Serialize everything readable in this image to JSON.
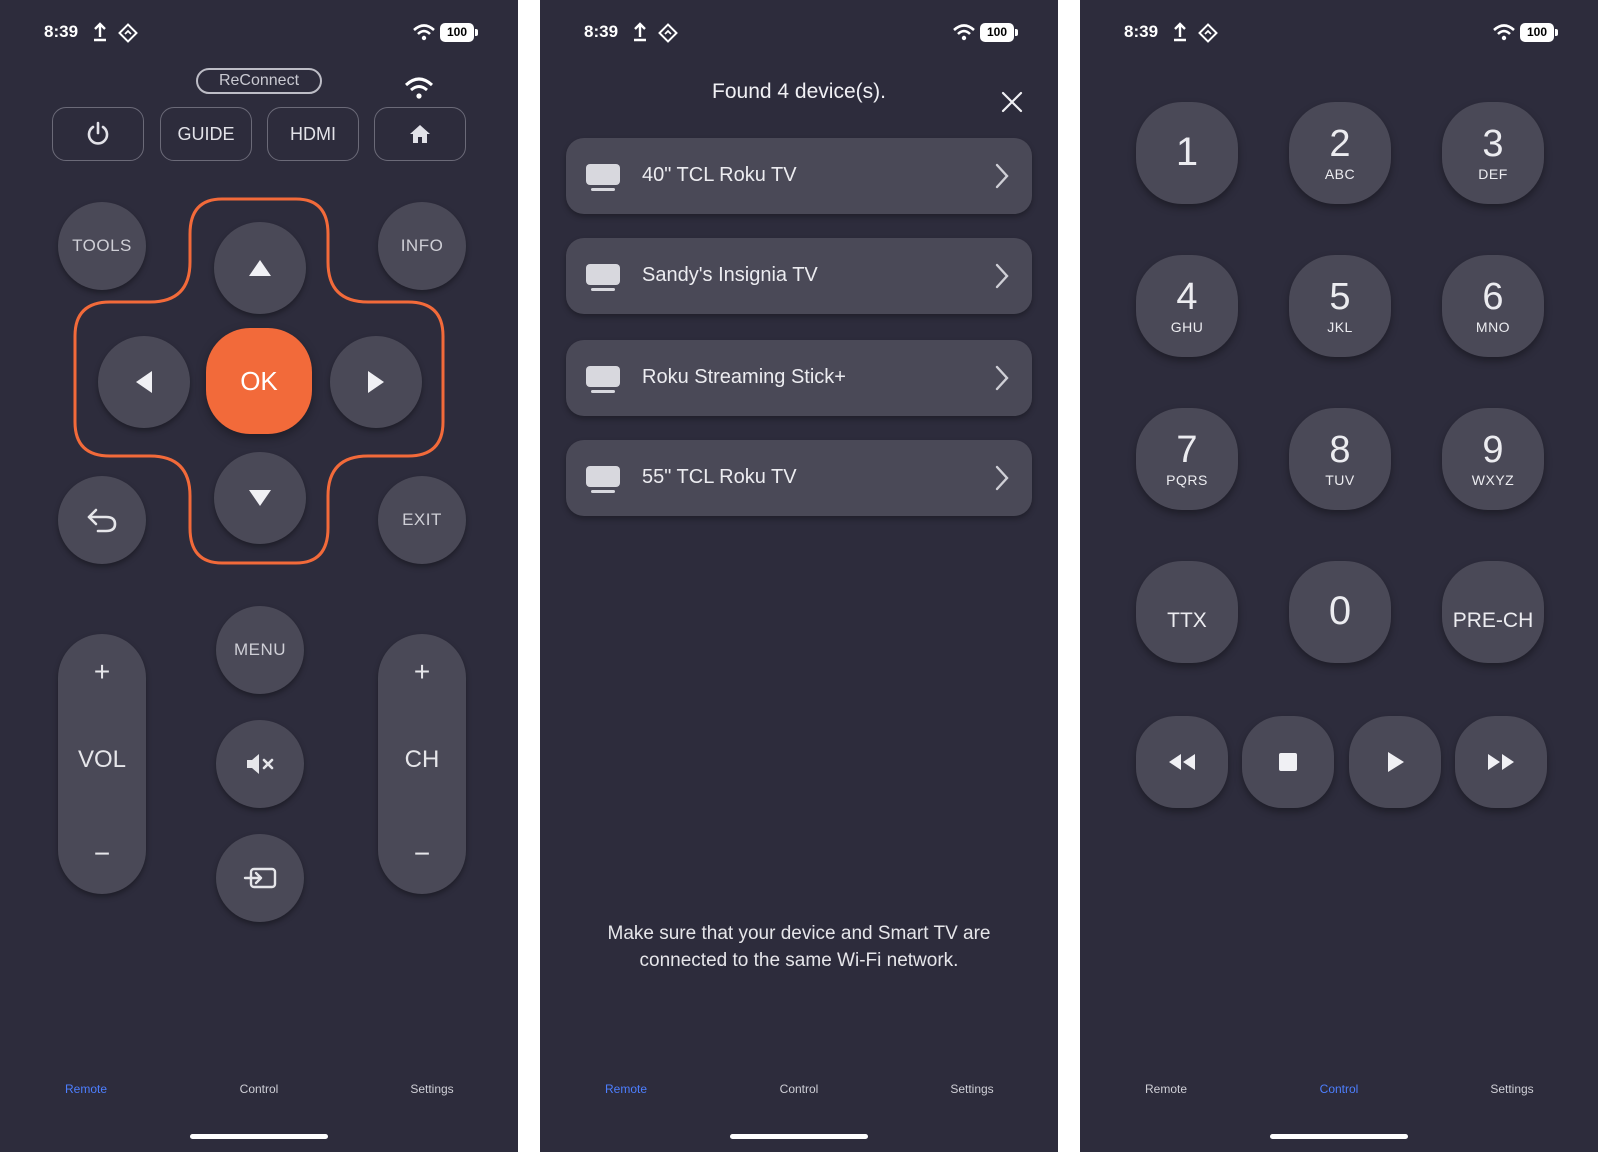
{
  "status": {
    "time": "8:39",
    "battery": "100"
  },
  "remote": {
    "reconnect_label": "ReConnect",
    "guide_label": "GUIDE",
    "hdmi_label": "HDMI",
    "tools_label": "TOOLS",
    "info_label": "INFO",
    "ok_label": "OK",
    "exit_label": "EXIT",
    "menu_label": "MENU",
    "vol_label": "VOL",
    "ch_label": "CH",
    "plus": "+",
    "minus": "−",
    "accent_color": "#f26a3a"
  },
  "devices": {
    "title": "Found 4 device(s).",
    "list": [
      {
        "name": "40\" TCL Roku TV"
      },
      {
        "name": "Sandy's Insignia TV"
      },
      {
        "name": "Roku Streaming Stick+"
      },
      {
        "name": "55\" TCL Roku TV"
      }
    ],
    "hint": "Make sure that your device and Smart TV are connected to the same Wi-Fi network."
  },
  "control": {
    "keys": [
      {
        "num": "1",
        "letters": ""
      },
      {
        "num": "2",
        "letters": "ABC"
      },
      {
        "num": "3",
        "letters": "DEF"
      },
      {
        "num": "4",
        "letters": "GHU"
      },
      {
        "num": "5",
        "letters": "JKL"
      },
      {
        "num": "6",
        "letters": "MNO"
      },
      {
        "num": "7",
        "letters": "PQRS"
      },
      {
        "num": "8",
        "letters": "TUV"
      },
      {
        "num": "9",
        "letters": "WXYZ"
      },
      {
        "num": "TTX",
        "letters": ""
      },
      {
        "num": "0",
        "letters": ""
      },
      {
        "num": "PRE-CH",
        "letters": ""
      }
    ]
  },
  "tabs": {
    "remote": "Remote",
    "control": "Control",
    "settings": "Settings",
    "active_color": "#4d7fff"
  },
  "icons": {
    "power": "power-icon",
    "home": "home-icon",
    "back": "back-arrow-icon",
    "mute": "mute-icon",
    "input": "input-source-icon",
    "tv": "tv-icon",
    "rewind": "rewind-icon",
    "stop": "stop-icon",
    "play": "play-icon",
    "fast_forward": "fast-forward-icon"
  }
}
